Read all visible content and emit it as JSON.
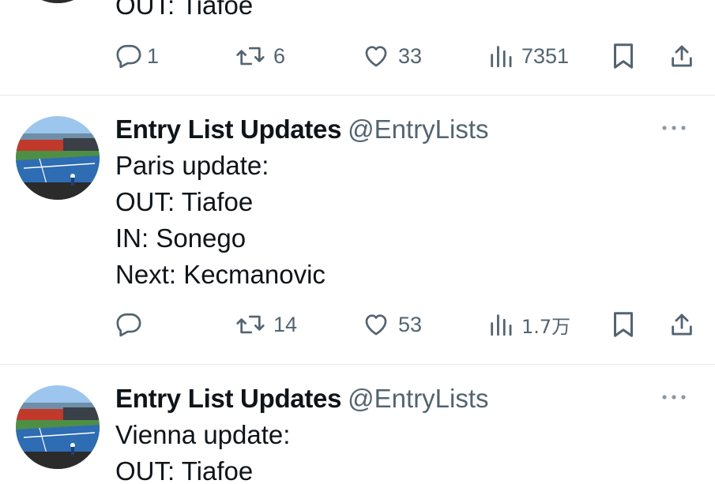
{
  "colors": {
    "text_primary": "#0f1419",
    "text_secondary": "#536471",
    "divider": "#e7e9ea",
    "background": "#ffffff"
  },
  "tweets": [
    {
      "author_name": "",
      "author_handle": "",
      "lines": [
        "OUT: Tiafoe"
      ],
      "replies": "1",
      "retweets": "6",
      "likes": "33",
      "views": "7351"
    },
    {
      "author_name": "Entry List Updates",
      "author_handle": "@EntryLists",
      "lines": [
        "Paris update:",
        "OUT: Tiafoe",
        "IN: Sonego",
        "Next: Kecmanovic"
      ],
      "replies": "",
      "retweets": "14",
      "likes": "53",
      "views": "1.7万"
    },
    {
      "author_name": "Entry List Updates",
      "author_handle": "@EntryLists",
      "lines": [
        "Vienna update:",
        "OUT: Tiafoe"
      ]
    }
  ],
  "icons": {
    "reply": "reply-icon",
    "retweet": "retweet-icon",
    "like": "heart-icon",
    "views": "views-icon",
    "bookmark": "bookmark-icon",
    "share": "share-icon",
    "more": "more-icon"
  }
}
